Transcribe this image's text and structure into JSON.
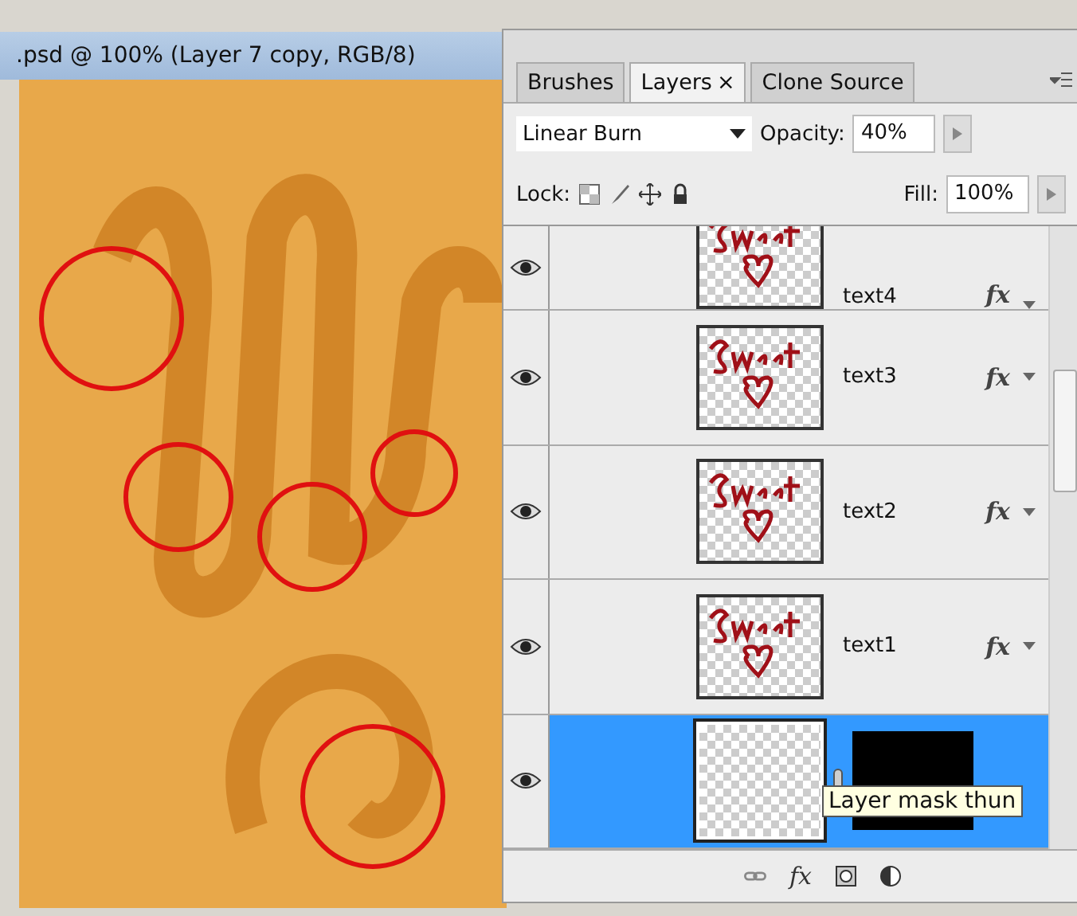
{
  "document": {
    "title": ".psd @ 100% (Layer 7 copy, RGB/8)"
  },
  "panel": {
    "tabs": [
      {
        "label": "Brushes",
        "selected": false,
        "closable": false
      },
      {
        "label": "Layers",
        "selected": true,
        "closable": true
      },
      {
        "label": "Clone Source",
        "selected": false,
        "closable": false
      }
    ],
    "close_glyph": "×",
    "blend_mode": "Linear Burn",
    "opacity_label": "Opacity:",
    "opacity": "40%",
    "lock_label": "Lock:",
    "fill_label": "Fill:",
    "fill": "100%"
  },
  "layers": [
    {
      "kind": "text",
      "name": "text4",
      "visible": true,
      "selected": false,
      "fx": "fx"
    },
    {
      "kind": "text",
      "name": "text3",
      "visible": true,
      "selected": false,
      "fx": "fx"
    },
    {
      "kind": "text",
      "name": "text2",
      "visible": true,
      "selected": false,
      "fx": "fx"
    },
    {
      "kind": "text",
      "name": "text1",
      "visible": true,
      "selected": false,
      "fx": "fx"
    },
    {
      "kind": "masked",
      "visible": true,
      "selected": true
    }
  ],
  "tooltip": "Layer mask thun",
  "footer": {
    "fx": "fx"
  }
}
